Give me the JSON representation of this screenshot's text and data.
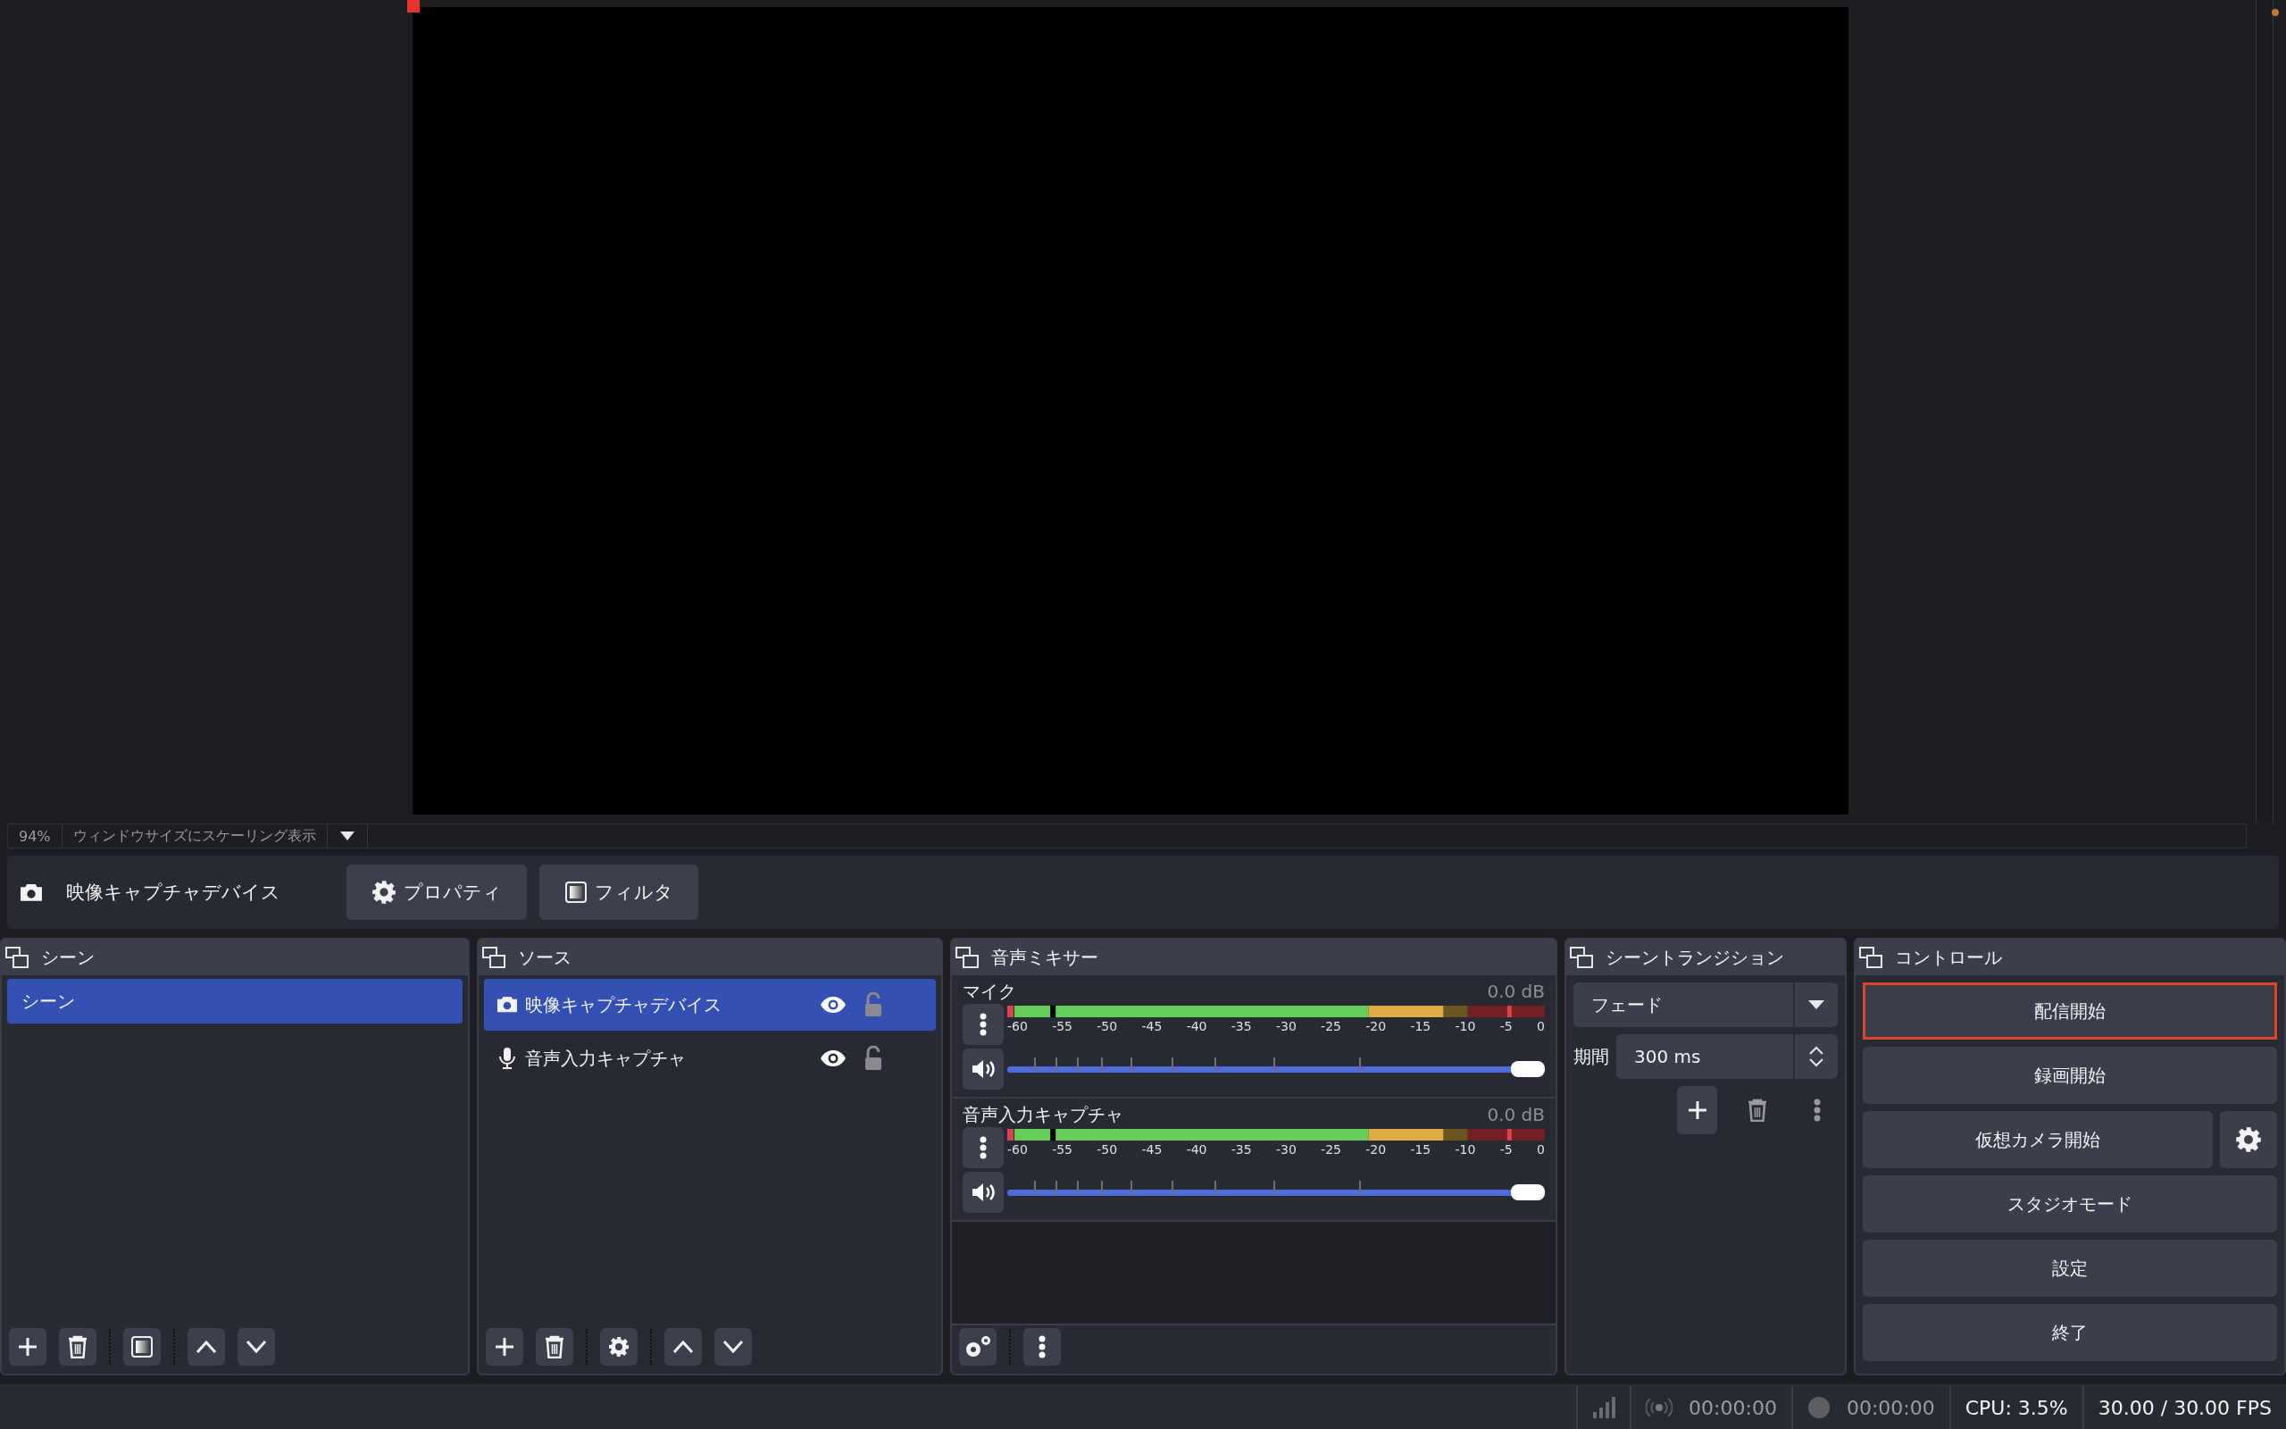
{
  "preview": {
    "zoom": "94%",
    "scale_mode": "ウィンドウサイズにスケーリング表示"
  },
  "source_toolbar": {
    "source": "映像キャプチャデバイス",
    "buttons": [
      {
        "kind": "properties",
        "label": "プロパティ"
      },
      {
        "kind": "filters",
        "label": "フィルタ"
      }
    ]
  },
  "scenes": {
    "title": "シーン",
    "items": [
      {
        "name": "シーン",
        "selected": true
      }
    ]
  },
  "sources": {
    "title": "ソース",
    "items": [
      {
        "name": "映像キャプチャデバイス",
        "kind": "camera",
        "selected": true,
        "visible": true,
        "locked": false
      },
      {
        "name": "音声入力キャプチャ",
        "kind": "mic",
        "selected": false,
        "visible": true,
        "locked": false
      }
    ]
  },
  "mixer": {
    "title": "音声ミキサー",
    "channels": [
      {
        "name": "マイク",
        "reading": "0.0 dB",
        "muted": false,
        "level": 1.0,
        "ticks": [
          "-60",
          "-55",
          "-50",
          "-45",
          "-40",
          "-35",
          "-30",
          "-25",
          "-20",
          "-15",
          "-10",
          "-5",
          "0"
        ]
      },
      {
        "name": "音声入力キャプチャ",
        "reading": "0.0 dB",
        "muted": false,
        "level": 1.0,
        "ticks": [
          "-60",
          "-55",
          "-50",
          "-45",
          "-40",
          "-35",
          "-30",
          "-25",
          "-20",
          "-15",
          "-10",
          "-5",
          "0"
        ]
      }
    ]
  },
  "transitions": {
    "title": "シーントランジション",
    "transition": "フェード",
    "duration_label": "期間",
    "duration": "300 ms"
  },
  "controls": {
    "title": "コントロール",
    "buttons": [
      {
        "kind": "plain",
        "label": "配信開始",
        "focused": true
      },
      {
        "kind": "plain",
        "label": "録画開始",
        "focused": false
      },
      {
        "kind": "with-settings",
        "label": "仮想カメラ開始",
        "focused": false
      },
      {
        "kind": "plain",
        "label": "スタジオモード",
        "focused": false
      },
      {
        "kind": "plain",
        "label": "設定",
        "focused": false
      },
      {
        "kind": "plain",
        "label": "終了",
        "focused": false
      }
    ]
  },
  "status_bar": {
    "stream_time": "00:00:00",
    "record_time": "00:00:00",
    "cpu": "CPU: 3.5%",
    "fps": "30.00 / 30.00 FPS"
  }
}
